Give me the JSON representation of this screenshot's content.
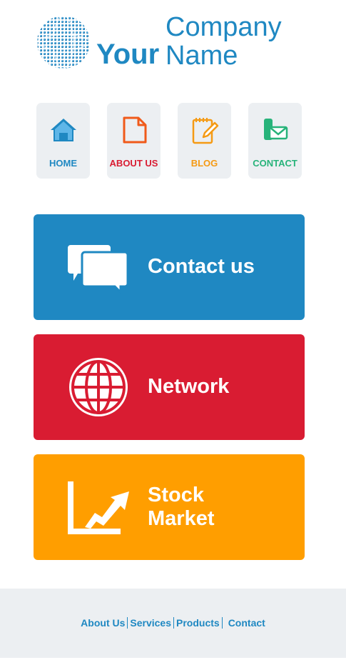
{
  "logo": {
    "word1": "Your",
    "word2": "Company Name",
    "icon": "globe-icon"
  },
  "nav": {
    "items": [
      {
        "label": "HOME",
        "icon": "home-icon",
        "color": "#1f88c2"
      },
      {
        "label": "ABOUT US",
        "icon": "document-icon",
        "color": "#d91c32"
      },
      {
        "label": "BLOG",
        "icon": "notepad-pencil-icon",
        "color": "#f59a14"
      },
      {
        "label": "CONTACT",
        "icon": "phone-mail-icon",
        "color": "#27b37a"
      }
    ]
  },
  "tiles": [
    {
      "label": "Contact us",
      "icon": "chat-bubbles-icon",
      "color": "#1f88c2"
    },
    {
      "label": "Network",
      "icon": "globe-grid-icon",
      "color": "#d91c32"
    },
    {
      "label": "Stock\nMarket",
      "icon": "trend-chart-icon",
      "color": "#ff9e00"
    }
  ],
  "footer": {
    "links": [
      "About Us",
      "Services",
      "Products",
      "Contact"
    ]
  }
}
